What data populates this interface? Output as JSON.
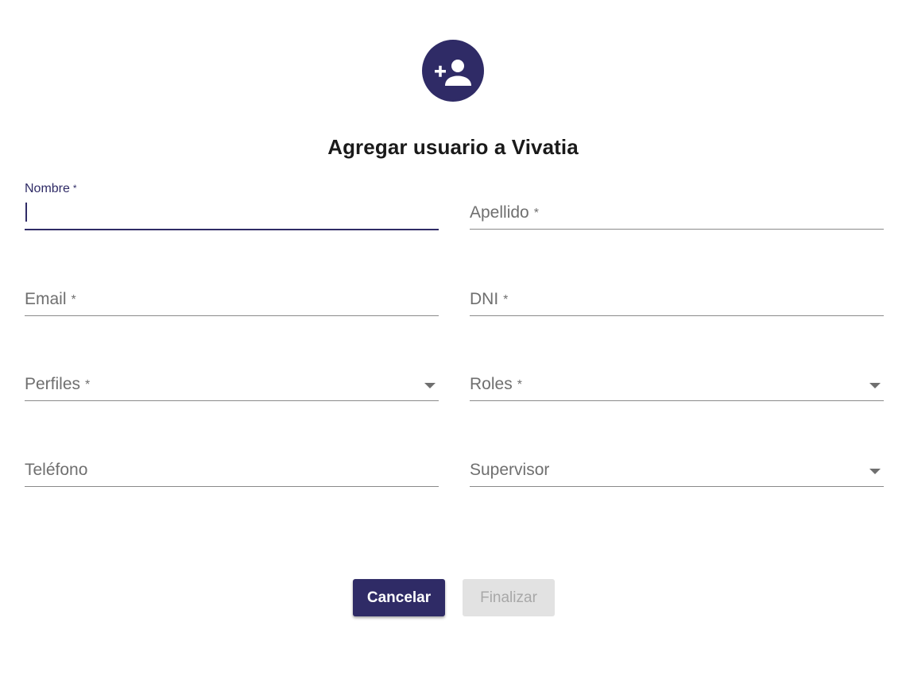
{
  "header": {
    "icon": "add-person-icon",
    "title": "Agregar usuario a Vivatia"
  },
  "form": {
    "fields": {
      "nombre": {
        "label": "Nombre",
        "required_mark": "*",
        "value": "",
        "state": "focused"
      },
      "apellido": {
        "label": "Apellido",
        "required_mark": "*",
        "value": ""
      },
      "email": {
        "label": "Email",
        "required_mark": "*",
        "value": ""
      },
      "dni": {
        "label": "DNI",
        "required_mark": "*",
        "value": ""
      },
      "perfiles": {
        "label": "Perfiles",
        "required_mark": "*",
        "type": "select",
        "icon": "dropdown-arrow-icon"
      },
      "roles": {
        "label": "Roles",
        "required_mark": "*",
        "type": "select",
        "icon": "dropdown-arrow-icon"
      },
      "telefono": {
        "label": "Teléfono",
        "value": ""
      },
      "supervisor": {
        "label": "Supervisor",
        "type": "select",
        "icon": "dropdown-arrow-icon"
      }
    }
  },
  "actions": {
    "cancel_label": "Cancelar",
    "finish_label": "Finalizar",
    "finish_disabled": true
  },
  "colors": {
    "primary": "#2f2b66",
    "disabled_bg": "#e2e2e2",
    "disabled_text": "#a8a8a8",
    "label": "#6f6f6f"
  }
}
